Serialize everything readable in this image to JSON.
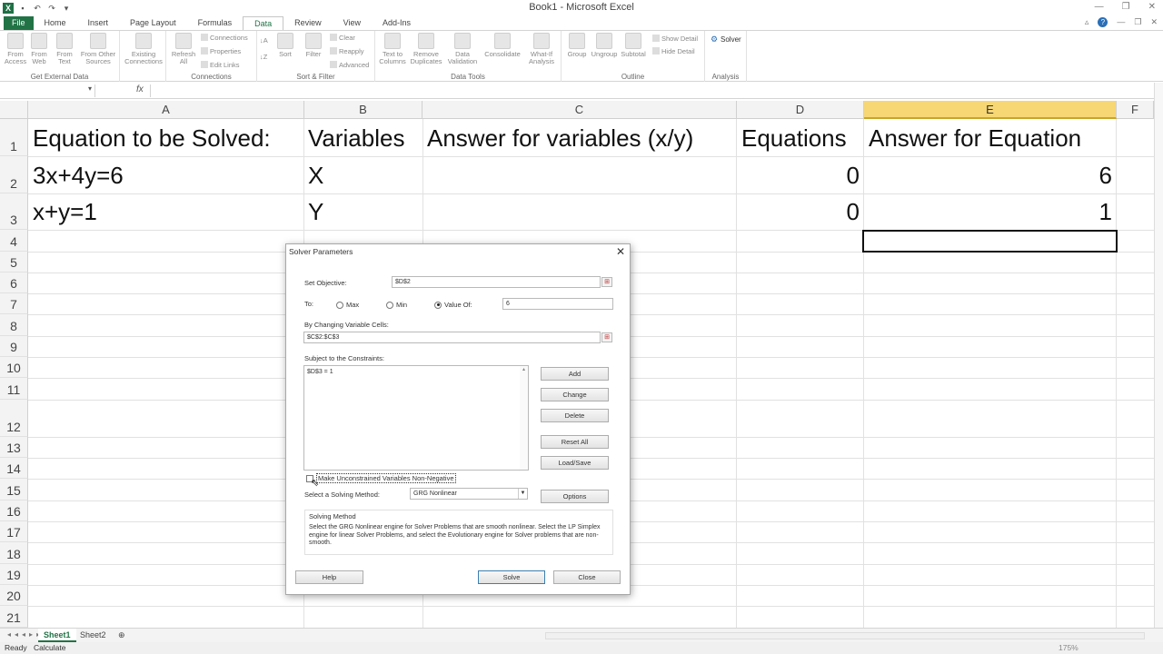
{
  "window": {
    "title": "Book1 - Microsoft Excel",
    "minimize": "—",
    "restore": "❐",
    "close": "✕"
  },
  "ribbon_tabs": [
    "File",
    "Home",
    "Insert",
    "Page Layout",
    "Formulas",
    "Data",
    "Review",
    "View",
    "Add-Ins"
  ],
  "active_tab": "Data",
  "ribbon": {
    "get_external": {
      "from_access": "From Access",
      "from_web": "From Web",
      "from_text": "From Text",
      "from_other": "From Other Sources",
      "label": "Get External Data"
    },
    "existing_connections": "Existing Connections",
    "connections": {
      "refresh": "Refresh All",
      "connections": "Connections",
      "properties": "Properties",
      "edit_links": "Edit Links",
      "label": "Connections"
    },
    "sort_filter": {
      "sort": "Sort",
      "filter": "Filter",
      "clear": "Clear",
      "reapply": "Reapply",
      "advanced": "Advanced",
      "label": "Sort & Filter"
    },
    "data_tools": {
      "text_to_columns": "Text to Columns",
      "remove_duplicates": "Remove Duplicates",
      "data_validation": "Data Validation",
      "consolidate": "Consolidate",
      "what_if": "What-If Analysis",
      "label": "Data Tools"
    },
    "outline": {
      "group": "Group",
      "ungroup": "Ungroup",
      "subtotal": "Subtotal",
      "show_detail": "Show Detail",
      "hide_detail": "Hide Detail",
      "label": "Outline"
    },
    "analysis": {
      "solver": "Solver",
      "label": "Analysis"
    }
  },
  "formula_bar": {
    "fx": "fx",
    "value": ""
  },
  "columns": [
    {
      "letter": "A",
      "selected": false
    },
    {
      "letter": "B",
      "selected": false
    },
    {
      "letter": "C",
      "selected": false
    },
    {
      "letter": "D",
      "selected": false
    },
    {
      "letter": "E",
      "selected": true
    },
    {
      "letter": "F",
      "selected": false
    }
  ],
  "rows": [
    "1",
    "2",
    "3",
    "4",
    "5",
    "6",
    "7",
    "8",
    "9",
    "10",
    "11",
    "12",
    "13",
    "14",
    "15",
    "16",
    "17",
    "18",
    "19",
    "20",
    "21"
  ],
  "cells": {
    "A1": "Equation to be Solved:",
    "B1": "Variables",
    "C1": "Answer for variables (x/y)",
    "D1": "Equations",
    "E1": "Answer for Equation",
    "A2": "3x+4y=6",
    "B2": "X",
    "D2": "0",
    "E2": "6",
    "A3": "x+y=1",
    "B3": "Y",
    "D3": "0",
    "E3": "1"
  },
  "sheets": [
    "Sheet1",
    "Sheet2"
  ],
  "status": {
    "ready": "Ready",
    "calculate": "Calculate",
    "zoom": "175%"
  },
  "dialog": {
    "title": "Solver Parameters",
    "set_objective_label": "Set Objective:",
    "set_objective_value": "$D$2",
    "to_label": "To:",
    "max_label": "Max",
    "min_label": "Min",
    "value_of_label": "Value Of:",
    "value_of_value": "6",
    "selected_option": "value_of",
    "changing_label": "By Changing Variable Cells:",
    "changing_value": "$C$2:$C$3",
    "constraints_label": "Subject to the Constraints:",
    "constraints": [
      "$D$3 = 1"
    ],
    "buttons": {
      "add": "Add",
      "change": "Change",
      "delete": "Delete",
      "reset": "Reset All",
      "load_save": "Load/Save",
      "options": "Options",
      "help": "Help",
      "solve": "Solve",
      "close": "Close"
    },
    "nonneg_label": "Make Unconstrained Variables Non-Negative",
    "nonneg_checked": false,
    "method_label": "Select a Solving Method:",
    "method_value": "GRG Nonlinear",
    "solving_method_title": "Solving Method",
    "solving_method_desc": "Select the GRG Nonlinear engine for Solver Problems that are smooth nonlinear. Select the LP Simplex engine for linear Solver Problems, and select the Evolutionary engine for Solver problems that are non-smooth."
  }
}
